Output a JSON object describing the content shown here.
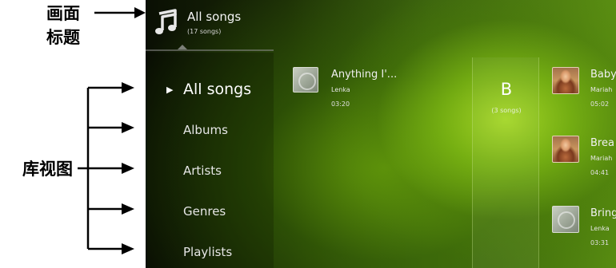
{
  "annotations": {
    "title_label_line1": "画面",
    "title_label_line2": "标题",
    "library_view_label": "库视图"
  },
  "header": {
    "icon": "music-note-icon",
    "title": "All songs",
    "subtitle": "(17 songs)"
  },
  "nav": {
    "items": [
      {
        "label": "All songs",
        "active": true
      },
      {
        "label": "Albums"
      },
      {
        "label": "Artists"
      },
      {
        "label": "Genres"
      },
      {
        "label": "Playlists"
      }
    ],
    "active_indicator": "▶"
  },
  "songs_column_1": [
    {
      "title": "Anything I'...",
      "artist": "Lenka",
      "time": "03:20",
      "art": "disc-icon"
    }
  ],
  "section": {
    "letter": "B",
    "count": "(3 songs)"
  },
  "songs_column_2": [
    {
      "title": "Baby",
      "artist": "Mariah",
      "time": "05:02",
      "art": "album-photo"
    },
    {
      "title": "Brea",
      "artist": "Mariah",
      "time": "04:41",
      "art": "album-photo"
    },
    {
      "title": "Bring",
      "artist": "Lenka",
      "time": "03:31",
      "art": "disc-icon"
    }
  ],
  "colors": {
    "accent_green": "#8cc21e",
    "text_primary": "#f4f4f4"
  }
}
